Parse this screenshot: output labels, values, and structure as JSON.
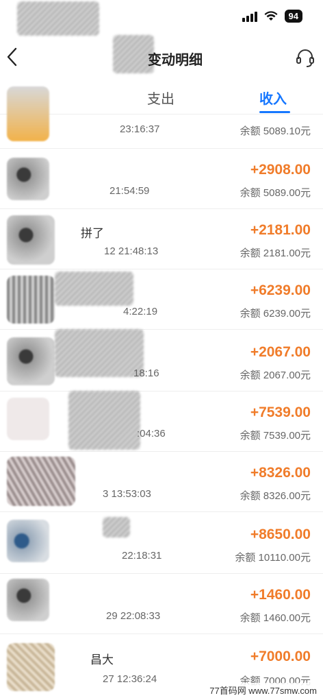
{
  "status_bar": {
    "battery": "94",
    "wifi_icon": "wifi-icon",
    "signal_icon": "signal-icon"
  },
  "header": {
    "title": "变动明细",
    "back_icon": "chevron-left-icon",
    "service_icon": "customer-service-icon"
  },
  "tabs": [
    {
      "label": "支出",
      "active": false
    },
    {
      "label": "收入",
      "active": true
    }
  ],
  "accent_color": "#1677ff",
  "amount_color": "#f07c2a",
  "transactions": [
    {
      "name": "",
      "time": "23:16:37",
      "amount": "",
      "balance": "余额 5089.10元"
    },
    {
      "name": "",
      "time": "21:54:59",
      "amount": "+2908.00",
      "balance": "余额 5089.00元"
    },
    {
      "name": "拼了",
      "time": "12 21:48:13",
      "amount": "+2181.00",
      "balance": "余额 2181.00元"
    },
    {
      "name": "",
      "time": "4:22:19",
      "amount": "+6239.00",
      "balance": "余额 6239.00元"
    },
    {
      "name": "",
      "time": "18:16",
      "amount": "+2067.00",
      "balance": "余额 2067.00元"
    },
    {
      "name": "",
      "time": ":04:36",
      "amount": "+7539.00",
      "balance": "余额 7539.00元"
    },
    {
      "name": "",
      "time": "3 13:53:03",
      "amount": "+8326.00",
      "balance": "余额 8326.00元"
    },
    {
      "name": "",
      "time": "22:18:31",
      "amount": "+8650.00",
      "balance": "余额 10110.00元"
    },
    {
      "name": "",
      "time": "29 22:08:33",
      "amount": "+1460.00",
      "balance": "余额 1460.00元"
    },
    {
      "name": "昌大",
      "time": "27 12:36:24",
      "amount": "+7000.00",
      "balance": "余额 7000.00元"
    }
  ],
  "watermark": "77首码网 www.77smw.com"
}
